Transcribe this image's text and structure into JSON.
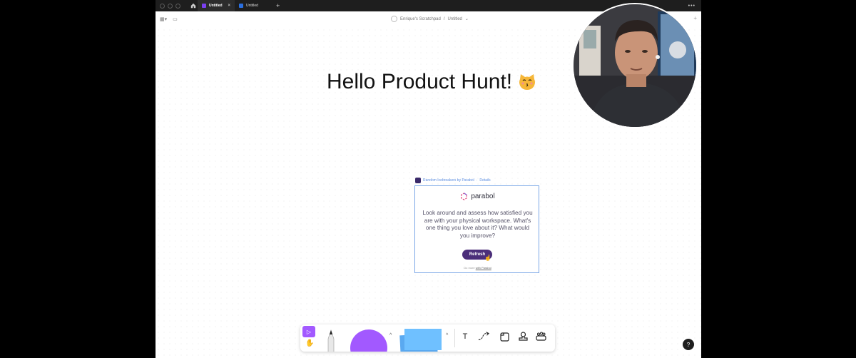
{
  "tabs": [
    {
      "label": "Untitled",
      "active": true
    },
    {
      "label": "Untitled",
      "active": false
    }
  ],
  "toolbar": {
    "breadcrumb_team": "Enrique's Scratchpad",
    "breadcrumb_sep": "/",
    "breadcrumb_file": "Untitled"
  },
  "canvas": {
    "heading": "Hello Product Hunt!"
  },
  "widget": {
    "label_prefix": "Random Icebreakers by Parabol",
    "label_details": "Details",
    "brand": "parabol",
    "prompt": "Look around and assess how satisfied you are with your physical workspace. What's one thing you love about it? What would you improve?",
    "refresh_label": "Refresh",
    "footer_prefix": "Do more",
    "footer_link": "with Parabol"
  },
  "dock": {
    "text_tool": "T"
  },
  "help_label": "?",
  "colors": {
    "accent": "#a259ff",
    "parabol": "#4b2e7a",
    "sticky": "#6fc0ff",
    "selection": "#7aa7e6"
  }
}
